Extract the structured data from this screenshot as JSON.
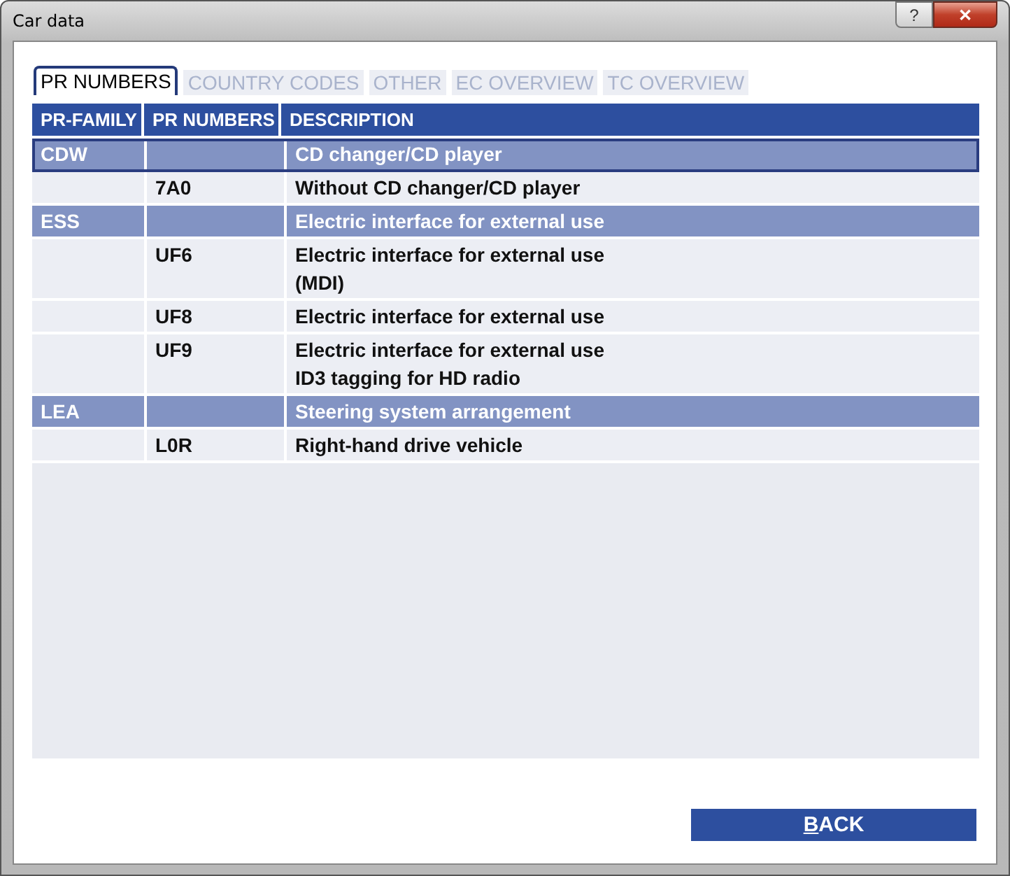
{
  "window": {
    "title": "Car data",
    "help_button": "?",
    "close_button": "✕"
  },
  "tabs": [
    {
      "label": "PR NUMBERS",
      "selected": true
    },
    {
      "label": "COUNTRY CODES",
      "selected": false
    },
    {
      "label": "OTHER",
      "selected": false
    },
    {
      "label": "EC OVERVIEW",
      "selected": false
    },
    {
      "label": "TC OVERVIEW",
      "selected": false
    }
  ],
  "table": {
    "columns": [
      "PR-FAMILY",
      "PR NUMBERS",
      "DESCRIPTION"
    ],
    "rows": [
      {
        "kind": "group",
        "selected": true,
        "cells": [
          "CDW",
          "",
          "CD changer/CD player"
        ]
      },
      {
        "kind": "item",
        "selected": false,
        "cells": [
          "",
          "7A0",
          "Without CD changer/CD player"
        ]
      },
      {
        "kind": "group",
        "selected": false,
        "cells": [
          "ESS",
          "",
          "Electric interface for external use"
        ]
      },
      {
        "kind": "item",
        "selected": false,
        "cells": [
          "",
          "UF6",
          "Electric interface for external use\n(MDI)"
        ]
      },
      {
        "kind": "item",
        "selected": false,
        "cells": [
          "",
          "UF8",
          "Electric interface for external use"
        ]
      },
      {
        "kind": "item",
        "selected": false,
        "cells": [
          "",
          "UF9",
          "Electric interface for external use\nID3 tagging for HD radio"
        ]
      },
      {
        "kind": "group",
        "selected": false,
        "cells": [
          "LEA",
          "",
          "Steering system arrangement"
        ]
      },
      {
        "kind": "item",
        "selected": false,
        "cells": [
          "",
          "L0R",
          "Right-hand drive vehicle"
        ]
      }
    ]
  },
  "buttons": [
    {
      "label": "BACK",
      "access_key": true
    }
  ]
}
